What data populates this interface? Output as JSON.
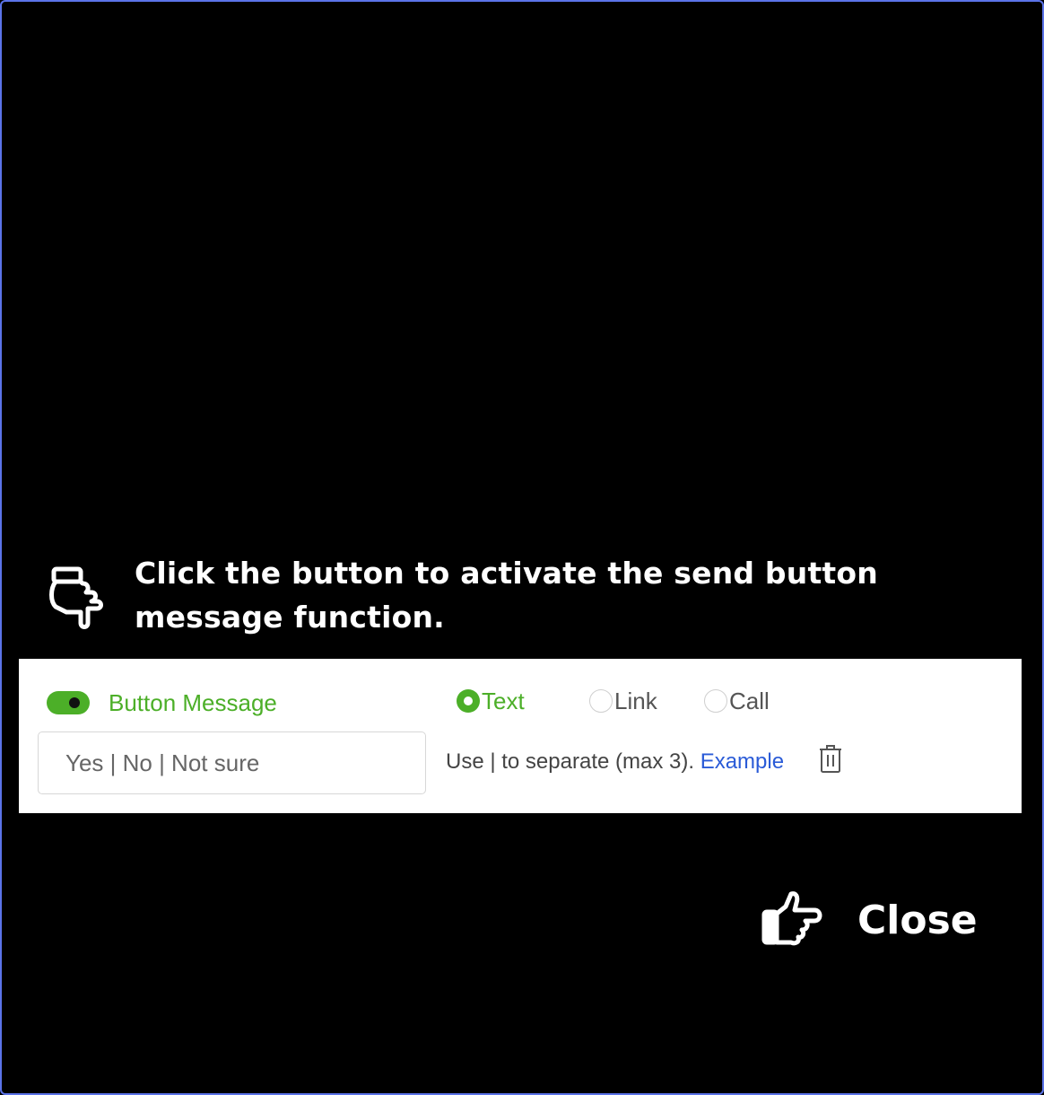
{
  "instruction": {
    "text": "Click the button to activate the send button message function.",
    "icon": "pointing-hand-down-icon"
  },
  "panel": {
    "toggle": {
      "label": "Button Message",
      "state": "on",
      "color": "#4caf28"
    },
    "radio_options": [
      {
        "label": "Text",
        "selected": true
      },
      {
        "label": "Link",
        "selected": false
      },
      {
        "label": "Call",
        "selected": false
      }
    ],
    "input": {
      "placeholder": "Yes | No | Not sure",
      "value": ""
    },
    "hint": {
      "text": "Use | to separate (max 3). ",
      "link_label": "Example"
    },
    "delete_icon": "trash-icon"
  },
  "close": {
    "label": "Close",
    "icon": "pointing-hand-right-icon"
  }
}
